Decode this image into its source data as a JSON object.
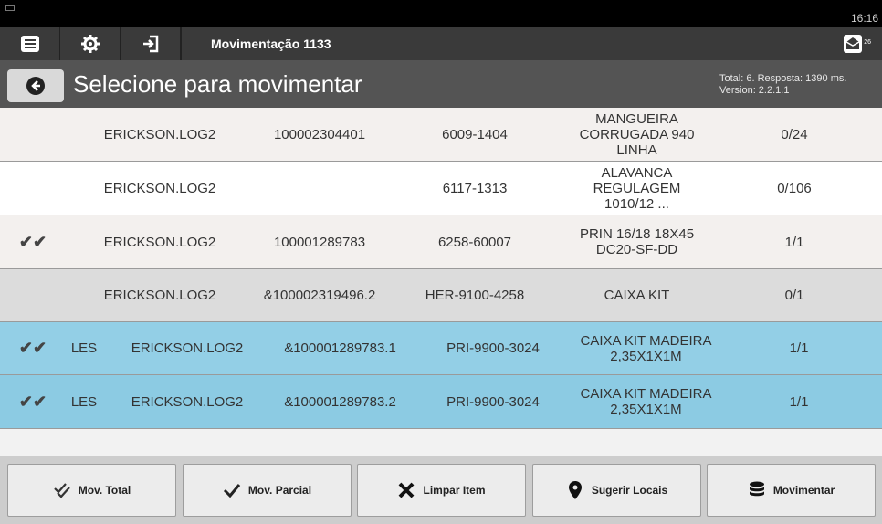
{
  "statusbar": {
    "time": "16:16",
    "keyboard_icon": "keyboard-icon"
  },
  "toolbar": {
    "menu_icon": "menu-icon",
    "settings_icon": "gear-icon",
    "login_icon": "sign-in-icon",
    "title": "Movimentação 1133",
    "mail_icon": "mail-icon",
    "mail_count": "26"
  },
  "header": {
    "back_icon": "back-arrow-icon",
    "title": "Selecione para movimentar",
    "info_line1": "Total: 6. Resposta: 1390 ms.",
    "info_line2": "Version: 2.2.1.1"
  },
  "rows": [
    {
      "check": "",
      "wh": "",
      "user": "ERICKSON.LOG2",
      "lot": "100002304401",
      "code": "6009-1404",
      "desc": "MANGUEIRA CORRUGADA 940 LINHA",
      "qty": "0/24",
      "bg": "#f3f0ee"
    },
    {
      "check": "",
      "wh": "",
      "user": "ERICKSON.LOG2",
      "lot": "",
      "code": "6117-1313",
      "desc": "ALAVANCA REGULAGEM 1010/12 ...",
      "qty": "0/106",
      "bg": "#ffffff"
    },
    {
      "check": "✔✔",
      "wh": "",
      "user": "ERICKSON.LOG2",
      "lot": "100001289783",
      "code": "6258-60007",
      "desc": "PRIN 16/18 18X45 DC20-SF-DD",
      "qty": "1/1",
      "bg": "#f3f0ee"
    },
    {
      "check": "",
      "wh": "",
      "user": "ERICKSON.LOG2",
      "lot": "&100002319496.2",
      "code": "HER-9100-4258",
      "desc": "CAIXA KIT",
      "qty": "0/1",
      "bg": "#dcdcdc"
    },
    {
      "check": "✔✔",
      "wh": "LES",
      "user": "ERICKSON.LOG2",
      "lot": "&100001289783.1",
      "code": "PRI-9900-3024",
      "desc": "CAIXA KIT MADEIRA 2,35X1X1M",
      "qty": "1/1",
      "bg": "#93cfe6"
    },
    {
      "check": "✔✔",
      "wh": "LES",
      "user": "ERICKSON.LOG2",
      "lot": "&100001289783.2",
      "code": "PRI-9900-3024",
      "desc": "CAIXA KIT MADEIRA 2,35X1X1M",
      "qty": "1/1",
      "bg": "#8ccbe3"
    }
  ],
  "footer": [
    {
      "label": "Mov. Total",
      "icon": "double-check-icon"
    },
    {
      "label": "Mov. Parcial",
      "icon": "check-icon"
    },
    {
      "label": "Limpar Item",
      "icon": "x-icon"
    },
    {
      "label": "Sugerir Locais",
      "icon": "map-marker-icon"
    },
    {
      "label": "Movimentar",
      "icon": "database-icon"
    }
  ]
}
